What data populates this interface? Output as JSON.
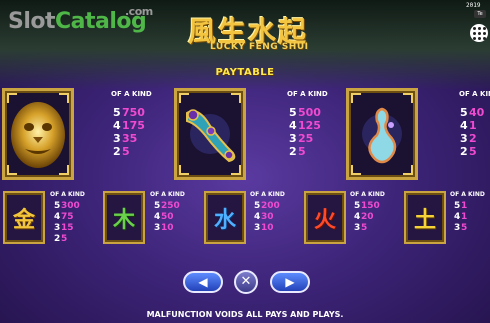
{
  "watermark": {
    "part1": "Slot",
    "part2": "Catalog",
    "suffix": ".com"
  },
  "logo": {
    "cn": "風生水起",
    "en": "LUCKY FENG SHUI"
  },
  "top_right": {
    "text": "2019",
    "btn": "Te"
  },
  "paytable_title": "PAYTABLE",
  "of_a_kind_label": "OF A KIND",
  "big_symbols": [
    {
      "icon": "golden-lion-icon",
      "pays": [
        {
          "n": "5",
          "v": "750"
        },
        {
          "n": "4",
          "v": "175"
        },
        {
          "n": "3",
          "v": "35"
        },
        {
          "n": "2",
          "v": "5"
        }
      ]
    },
    {
      "icon": "jade-ruyi-icon",
      "pays": [
        {
          "n": "5",
          "v": "500"
        },
        {
          "n": "4",
          "v": "125"
        },
        {
          "n": "3",
          "v": "25"
        },
        {
          "n": "2",
          "v": "5"
        }
      ]
    },
    {
      "icon": "gourd-icon",
      "pays": [
        {
          "n": "5",
          "v": "40"
        },
        {
          "n": "4",
          "v": "1"
        },
        {
          "n": "3",
          "v": "2"
        },
        {
          "n": "2",
          "v": "5"
        }
      ]
    }
  ],
  "small_symbols": [
    {
      "glyph": "金",
      "icon": "metal-icon",
      "pays": [
        {
          "n": "5",
          "v": "300"
        },
        {
          "n": "4",
          "v": "75"
        },
        {
          "n": "3",
          "v": "15"
        },
        {
          "n": "2",
          "v": "5"
        }
      ]
    },
    {
      "glyph": "木",
      "icon": "wood-icon",
      "pays": [
        {
          "n": "5",
          "v": "250"
        },
        {
          "n": "4",
          "v": "50"
        },
        {
          "n": "3",
          "v": "10"
        }
      ]
    },
    {
      "glyph": "水",
      "icon": "water-icon",
      "pays": [
        {
          "n": "5",
          "v": "200"
        },
        {
          "n": "4",
          "v": "30"
        },
        {
          "n": "3",
          "v": "10"
        }
      ]
    },
    {
      "glyph": "火",
      "icon": "fire-icon",
      "pays": [
        {
          "n": "5",
          "v": "150"
        },
        {
          "n": "4",
          "v": "20"
        },
        {
          "n": "3",
          "v": "5"
        }
      ]
    },
    {
      "glyph": "土",
      "icon": "earth-icon",
      "pays": [
        {
          "n": "5",
          "v": "1"
        },
        {
          "n": "4",
          "v": "1"
        },
        {
          "n": "3",
          "v": "5"
        }
      ]
    }
  ],
  "nav": {
    "prev": "◀",
    "close": "✕",
    "next": "▶"
  },
  "footer": "MALFUNCTION VOIDS ALL PAYS AND PLAYS."
}
